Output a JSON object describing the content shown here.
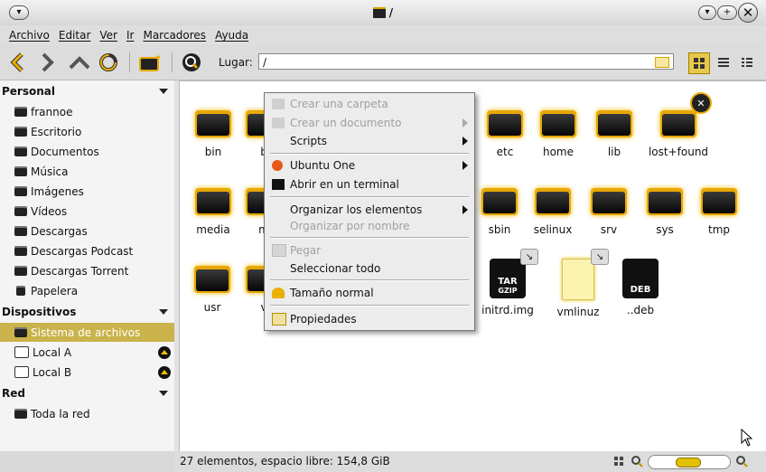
{
  "window": {
    "title": "/"
  },
  "menubar": [
    "Archivo",
    "Editar",
    "Ver",
    "Ir",
    "Marcadores",
    "Ayuda"
  ],
  "location": {
    "label": "Lugar:",
    "value": "/"
  },
  "sidebar": {
    "personal_header": "Personal",
    "personal": [
      "frannoe",
      "Escritorio",
      "Documentos",
      "Música",
      "Imágenes",
      "Vídeos",
      "Descargas",
      "Descargas Podcast",
      "Descargas Torrent",
      "Papelera"
    ],
    "devices_header": "Dispositivos",
    "devices": [
      "Sistema de archivos",
      "Local A",
      "Local B"
    ],
    "network_header": "Red",
    "network": [
      "Toda la red"
    ]
  },
  "files": {
    "row1": [
      "bin",
      "b",
      "",
      "",
      "etc",
      "home",
      "lib",
      "lost+found"
    ],
    "row2": [
      "media",
      "m",
      "",
      "",
      "sbin",
      "selinux",
      "srv",
      "sys",
      "tmp"
    ],
    "row3": [
      "usr",
      "v",
      "",
      "",
      "initrd.img",
      "vmlinuz",
      "..deb"
    ],
    "archive_labels": {
      "tar": "TAR",
      "gzip": "GZIP",
      "deb": "DEB"
    }
  },
  "context_menu": [
    {
      "label": "Crear una carpeta",
      "disabled": true
    },
    {
      "label": "Crear un documento",
      "disabled": true,
      "submenu": true
    },
    {
      "label": "Scripts",
      "disabled": false,
      "submenu": true
    },
    {
      "label": "Ubuntu One",
      "disabled": false,
      "submenu": true
    },
    {
      "label": "Abrir en un terminal",
      "disabled": false
    },
    {
      "label": "Organizar los elementos",
      "disabled": false,
      "submenu": true
    },
    {
      "label": "Organizar por nombre",
      "disabled": true
    },
    {
      "label": "Pegar",
      "disabled": true
    },
    {
      "label": "Seleccionar todo",
      "disabled": false
    },
    {
      "label": "Tamaño normal",
      "disabled": false
    },
    {
      "label": "Propiedades",
      "disabled": false
    }
  ],
  "status": {
    "text": "27 elementos, espacio libre: 154,8 GiB",
    "zoom_level": 0.4
  },
  "colors": {
    "accent": "#e8a800",
    "selection": "#c9b34a"
  }
}
